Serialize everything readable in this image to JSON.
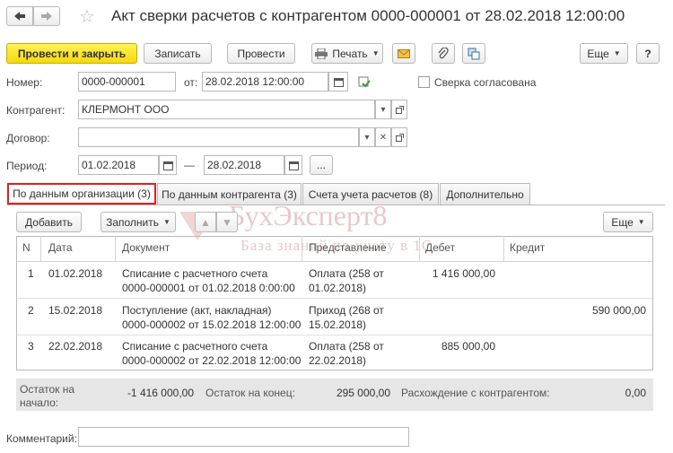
{
  "header": {
    "back_label": "◄",
    "forward_label": "►",
    "title": "Акт сверки расчетов с контрагентом 0000-000001 от 28.02.2018 12:00:00"
  },
  "toolbar": {
    "post_close_label": "Провести и закрыть",
    "save_label": "Записать",
    "post_label": "Провести",
    "print_label": "Печать",
    "more_label": "Еще",
    "help_label": "?"
  },
  "form": {
    "number_label": "Номер:",
    "number_value": "0000-000001",
    "from_label": "от:",
    "date_value": "28.02.2018 12:00:00",
    "agreed_label": "Сверка согласована",
    "counterparty_label": "Контрагент:",
    "counterparty_value": "КЛЕРМОНТ ООО",
    "contract_label": "Договор:",
    "contract_value": "",
    "period_label": "Период:",
    "period_from": "01.02.2018",
    "period_dash": "—",
    "period_to": "28.02.2018",
    "period_more": "...",
    "comment_label": "Комментарий:",
    "comment_value": ""
  },
  "tabs": [
    {
      "label": "По данным организации (3)",
      "active": true
    },
    {
      "label": "По данным контрагента (3)",
      "active": false
    },
    {
      "label": "Счета учета расчетов (8)",
      "active": false
    },
    {
      "label": "Дополнительно",
      "active": false
    }
  ],
  "table_toolbar": {
    "add_label": "Добавить",
    "fill_label": "Заполнить",
    "more_label": "Еще"
  },
  "table": {
    "columns": [
      "N",
      "Дата",
      "Документ",
      "Представление",
      "Дебет",
      "Кредит"
    ],
    "rows": [
      {
        "n": "1",
        "date": "01.02.2018",
        "doc1": "Списание с расчетного счета",
        "doc2": "0000-000001 от 01.02.2018 0:00:00",
        "rep1": "Оплата (258 от",
        "rep2": "01.02.2018)",
        "debit": "1 416 000,00",
        "credit": ""
      },
      {
        "n": "2",
        "date": "15.02.2018",
        "doc1": "Поступление (акт, накладная)",
        "doc2": "0000-000002 от 15.02.2018 12:00:00",
        "rep1": "Приход (268 от",
        "rep2": "15.02.2018)",
        "debit": "",
        "credit": "590 000,00"
      },
      {
        "n": "3",
        "date": "22.02.2018",
        "doc1": "Списание с расчетного счета",
        "doc2": "0000-000002 от 22.02.2018 12:00:00",
        "rep1": "Оплата (258 от",
        "rep2": "22.02.2018)",
        "debit": "885 000,00",
        "credit": ""
      }
    ]
  },
  "footer": {
    "start_label_1": "Остаток на",
    "start_label_2": "начало:",
    "start_value": "-1 416 000,00",
    "end_label": "Остаток на конец:",
    "end_value": "295 000,00",
    "diff_label": "Расхождение с контрагентом:",
    "diff_value": "0,00"
  },
  "watermark": {
    "brand": "БухЭксперт8",
    "tagline": "База знаний по учету в 1С"
  }
}
